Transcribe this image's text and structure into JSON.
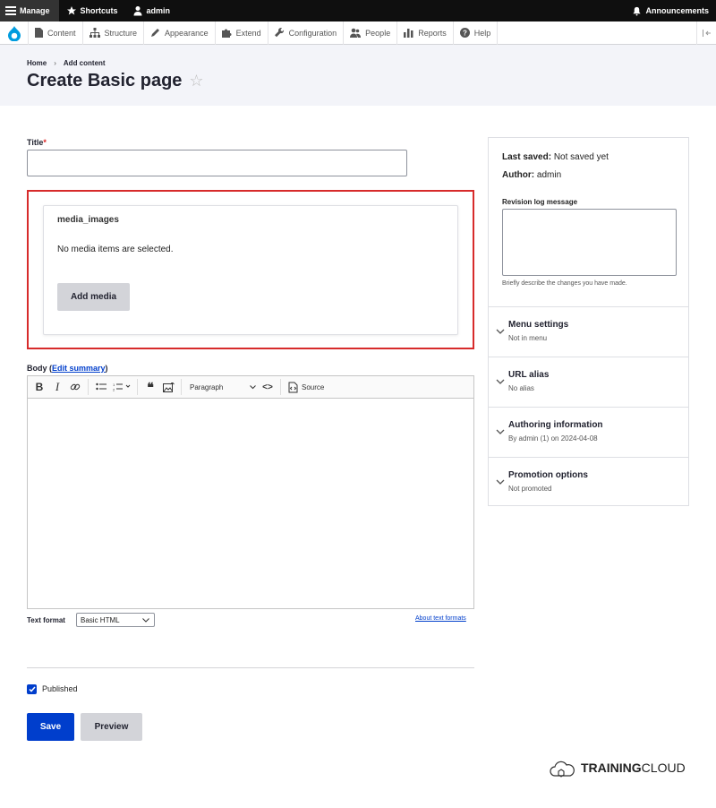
{
  "toolbar": {
    "manage": "Manage",
    "shortcuts": "Shortcuts",
    "user": "admin",
    "announcements": "Announcements"
  },
  "admin_menu": {
    "items": [
      "Content",
      "Structure",
      "Appearance",
      "Extend",
      "Configuration",
      "People",
      "Reports",
      "Help"
    ]
  },
  "breadcrumb": {
    "home": "Home",
    "separator": "›",
    "current": "Add content"
  },
  "page": {
    "title": "Create Basic page",
    "star": "☆"
  },
  "form": {
    "title_label": "Title",
    "required_mark": "*",
    "media_title": "media_images",
    "media_empty": "No media items are selected.",
    "add_media": "Add media",
    "body_label": "Body (",
    "edit_summary": "Edit summary",
    "body_label_end": ")",
    "paragraph": "Paragraph",
    "source": "Source",
    "text_format_label": "Text format",
    "text_format_value": "Basic HTML",
    "about_text_formats": "About text formats",
    "published": "Published",
    "save": "Save",
    "preview": "Preview"
  },
  "sidebar": {
    "last_saved_label": "Last saved:",
    "last_saved_value": "Not saved yet",
    "author_label": "Author:",
    "author_value": "admin",
    "revision_label": "Revision log message",
    "revision_help": "Briefly describe the changes you have made.",
    "sections": [
      {
        "title": "Menu settings",
        "sub": "Not in menu"
      },
      {
        "title": "URL alias",
        "sub": "No alias"
      },
      {
        "title": "Authoring information",
        "sub": "By admin (1) on 2024-04-08"
      },
      {
        "title": "Promotion options",
        "sub": "Not promoted"
      }
    ]
  },
  "brand": {
    "bold": "TRAINING",
    "rest": "CLOUD"
  },
  "colors": {
    "accent": "#003ecc",
    "highlight": "#d72b2b",
    "toolbar": "#0f0f0f"
  }
}
